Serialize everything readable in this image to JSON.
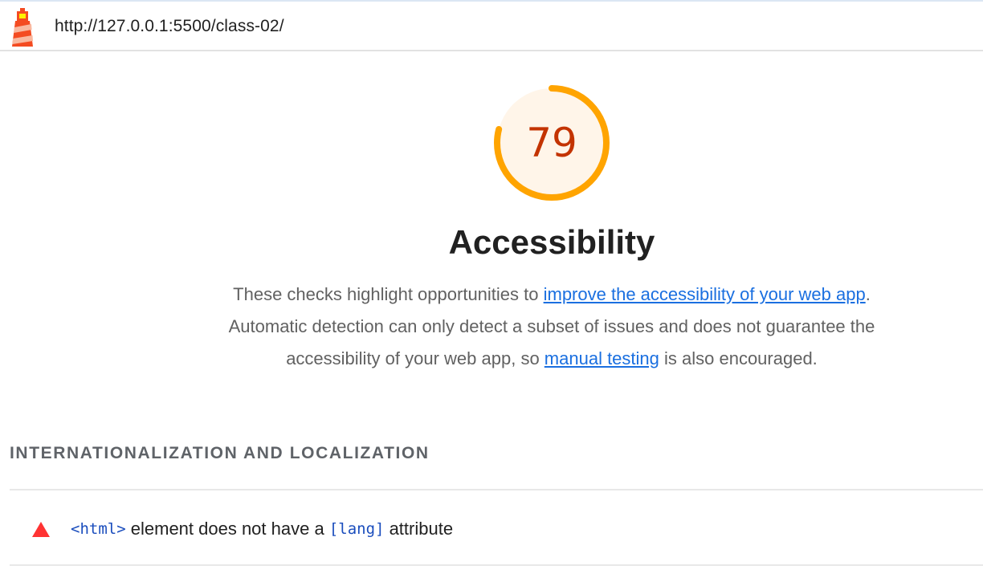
{
  "header": {
    "url": "http://127.0.0.1:5500/class-02/",
    "logo_icon": "lighthouse-icon"
  },
  "score": {
    "value": "79",
    "fraction": 0.79,
    "color": "#ffa400",
    "text_color": "#c33300"
  },
  "category": {
    "title": "Accessibility",
    "description_part1": "These checks highlight opportunities to ",
    "link1": "improve the accessibility of your web app",
    "description_part2": ". Automatic detection can only detect a subset of issues and does not guarantee the accessibility of your web app, so ",
    "link2": "manual testing",
    "description_part3": " is also encouraged."
  },
  "group": {
    "title": "INTERNATIONALIZATION AND LOCALIZATION"
  },
  "audits": [
    {
      "icon": "fail-triangle-icon",
      "code1": "<html>",
      "text1": " element does not have a ",
      "code2": "[lang]",
      "text2": " attribute"
    }
  ]
}
